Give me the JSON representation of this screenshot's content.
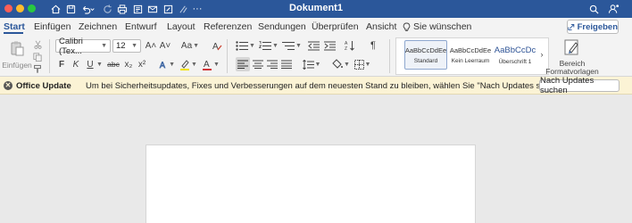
{
  "window": {
    "title": "Dokument1",
    "traffic_lights": {
      "close": "#fe5f57",
      "minimize": "#febc2e",
      "zoom": "#28c840"
    },
    "brand_color": "#2b579a"
  },
  "quick_access": {
    "icons": [
      "home-icon",
      "save-icon",
      "undo-icon",
      "redo-icon",
      "print-icon",
      "template-icon",
      "mail-icon",
      "edit-icon",
      "brush-icon"
    ],
    "more_label": "···"
  },
  "title_bar_right": [
    "search-icon",
    "account-icon"
  ],
  "tabs": [
    {
      "label": "Start",
      "active": true
    },
    {
      "label": "Einfügen"
    },
    {
      "label": "Zeichnen"
    },
    {
      "label": "Entwurf"
    },
    {
      "label": "Layout"
    },
    {
      "label": "Referenzen"
    },
    {
      "label": "Sendungen"
    },
    {
      "label": "Überprüfen"
    },
    {
      "label": "Ansicht"
    }
  ],
  "tell_me": {
    "label": "Sie wünschen"
  },
  "share": {
    "label": "Freigeben"
  },
  "ribbon": {
    "paste_label": "Einfügen",
    "font_name": "Calibri (Tex...",
    "font_size": "12",
    "grow_label": "A˄",
    "shrink_label": "A˅",
    "case_label": "Aa",
    "format_buttons": {
      "bold": "F",
      "italic": "K",
      "underline": "U",
      "strike": "abc",
      "subscript": "x₂",
      "superscript": "x²"
    },
    "pilcrow": "¶",
    "styles": [
      {
        "sample": "AaBbCcDdEe",
        "name": "Standard",
        "active": true
      },
      {
        "sample": "AaBbCcDdEe",
        "name": "Kein Leerraum"
      },
      {
        "sample": "AaBbCcDc",
        "name": "Überschrift 1"
      }
    ],
    "styles_pane": {
      "line1": "Bereich",
      "line2": "Formatvorlagen"
    },
    "highlight_color": "#f2e400",
    "font_color": "#d13438"
  },
  "notice": {
    "title": "Office Update",
    "message": "Um bei Sicherheitsupdates, Fixes und Verbesserungen auf dem neuesten Stand zu bleiben, wählen Sie \"Nach Updates suchen\" aus.",
    "button": "Nach Updates suchen"
  }
}
